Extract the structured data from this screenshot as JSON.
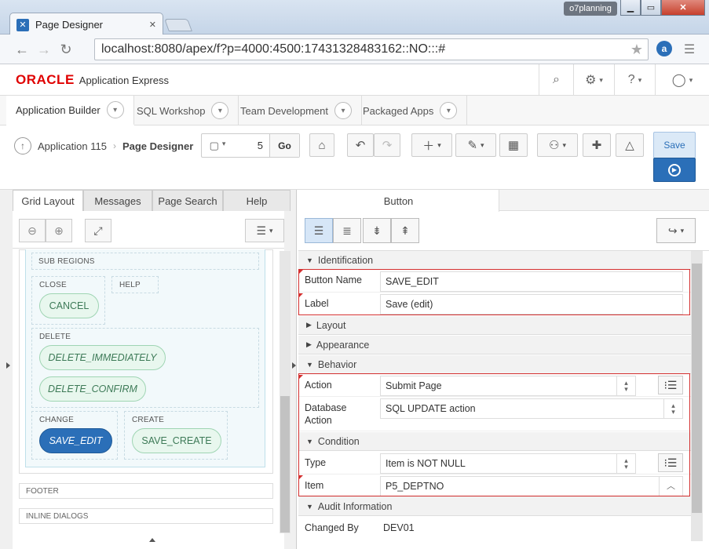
{
  "browser": {
    "tab_title": "Page Designer",
    "profile": "o7planning",
    "url": "localhost:8080/apex/f?p=4000:4500:17431328483162::NO:::#"
  },
  "apex": {
    "brand": "ORACLE",
    "product": "Application Express"
  },
  "nav_tabs": [
    "Application Builder",
    "SQL Workshop",
    "Team Development",
    "Packaged Apps"
  ],
  "toolbar": {
    "breadcrumb_app": "Application 115",
    "breadcrumb_page": "Page Designer",
    "page_number": "5",
    "go_label": "Go",
    "save_label": "Save"
  },
  "left_tabs": [
    "Grid Layout",
    "Messages",
    "Page Search",
    "Help"
  ],
  "grid": {
    "sub_regions": "SUB REGIONS",
    "close": "CLOSE",
    "help": "HELP",
    "cancel": "CANCEL",
    "delete": "DELETE",
    "delete_immediately": "DELETE_IMMEDIATELY",
    "delete_confirm": "DELETE_CONFIRM",
    "change": "CHANGE",
    "save_edit": "SAVE_EDIT",
    "create": "CREATE",
    "save_create": "SAVE_CREATE",
    "footer": "FOOTER",
    "inline_dialogs": "INLINE DIALOGS"
  },
  "right": {
    "tab": "Button",
    "groups": {
      "identification": "Identification",
      "layout": "Layout",
      "appearance": "Appearance",
      "behavior": "Behavior",
      "condition": "Condition",
      "audit": "Audit Information"
    },
    "props": {
      "button_name_label": "Button Name",
      "button_name_value": "SAVE_EDIT",
      "label_label": "Label",
      "label_value": "Save (edit)",
      "action_label": "Action",
      "action_value": "Submit Page",
      "db_action_label_1": "Database",
      "db_action_label_2": "Action",
      "db_action_value": "SQL UPDATE action",
      "type_label": "Type",
      "type_value": "Item is NOT NULL",
      "item_label": "Item",
      "item_value": "P5_DEPTNO",
      "changed_by_label": "Changed By",
      "changed_by_value": "DEV01"
    }
  },
  "colors": {
    "oracle_red": "#e00000",
    "selected_button": "#2b6fb8",
    "save_blue": "#2b6fb8",
    "required_red": "#d32f2f"
  }
}
